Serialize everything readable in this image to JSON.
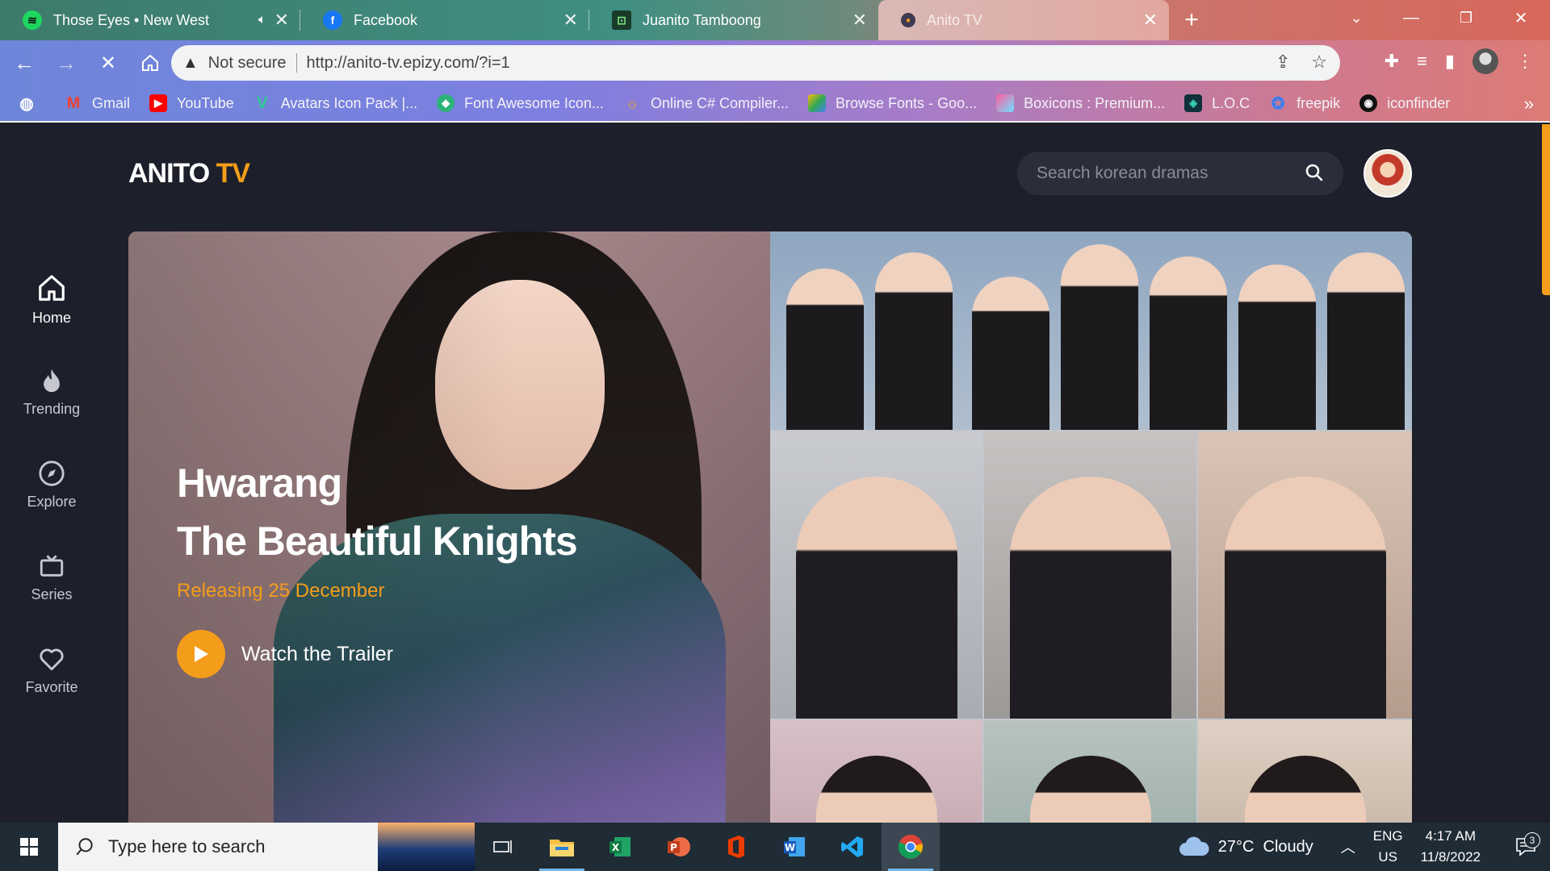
{
  "tabs": [
    {
      "title": "Those Eyes • New West",
      "favicon": "spotify-icon",
      "audio": true
    },
    {
      "title": "Facebook",
      "favicon": "facebook-icon"
    },
    {
      "title": "Juanito Tamboong",
      "favicon": "juanito-icon"
    },
    {
      "title": "Anito TV",
      "favicon": "anito-icon",
      "active": true
    }
  ],
  "address_bar": {
    "security_label": "Not secure",
    "url": "http://anito-tv.epizy.com/?i=1"
  },
  "bookmarks": [
    {
      "label": "Gmail",
      "icon": "gmail-icon"
    },
    {
      "label": "YouTube",
      "icon": "youtube-icon"
    },
    {
      "label": "Avatars Icon Pack |...",
      "icon": "avatars-icon"
    },
    {
      "label": "Font Awesome Icon...",
      "icon": "fontawesome-icon"
    },
    {
      "label": "Online C# Compiler...",
      "icon": "compiler-icon"
    },
    {
      "label": "Browse Fonts - Goo...",
      "icon": "google-fonts-icon"
    },
    {
      "label": "Boxicons : Premium...",
      "icon": "boxicons-icon"
    },
    {
      "label": "L.O.C",
      "icon": "loc-icon"
    },
    {
      "label": "freepik",
      "icon": "freepik-icon"
    },
    {
      "label": "iconfinder",
      "icon": "iconfinder-icon"
    }
  ],
  "site": {
    "brand_main": "ANITO",
    "brand_accent": "TV",
    "accent_color": "#f49d1a",
    "background_color": "#1d1f2b",
    "search_placeholder": "Search korean dramas"
  },
  "sidenav": [
    {
      "label": "Home",
      "icon": "home-icon",
      "active": true
    },
    {
      "label": "Trending",
      "icon": "fire-icon"
    },
    {
      "label": "Explore",
      "icon": "compass-icon"
    },
    {
      "label": "Series",
      "icon": "tv-icon"
    },
    {
      "label": "Favorite",
      "icon": "heart-icon"
    }
  ],
  "hero": {
    "title_line1": "Hwarang",
    "title_line2": "The Beautiful Knights",
    "release": "Releasing 25 December",
    "trailer_label": "Watch the Trailer"
  },
  "taskbar": {
    "search_placeholder": "Type here to search",
    "weather": "27°C  Cloudy",
    "lang_line1": "ENG",
    "lang_line2": "US",
    "time": "4:17 AM",
    "date": "11/8/2022",
    "notification_count": "3"
  }
}
